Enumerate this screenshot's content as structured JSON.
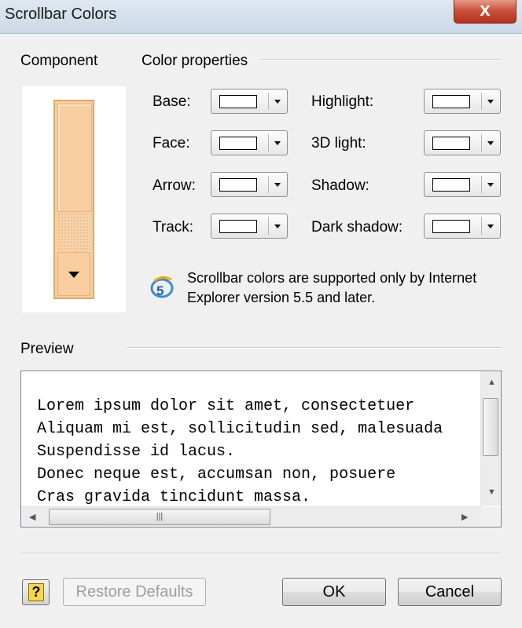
{
  "window": {
    "title": "Scrollbar Colors",
    "close_label": "x"
  },
  "component": {
    "label": "Component"
  },
  "color_properties": {
    "label": "Color properties",
    "left": [
      {
        "label": "Base:"
      },
      {
        "label": "Face:"
      },
      {
        "label": "Arrow:"
      },
      {
        "label": "Track:"
      }
    ],
    "right": [
      {
        "label": "Highlight:"
      },
      {
        "label": "3D light:"
      },
      {
        "label": "Shadow:"
      },
      {
        "label": "Dark shadow:"
      }
    ],
    "swatch_color": "#ffffff"
  },
  "info": {
    "icon": "ie5-icon",
    "line1": "Scrollbar colors are supported only by Internet",
    "line2": "Explorer version 5.5 and later."
  },
  "preview": {
    "label": "Preview",
    "lines": [
      "Lorem ipsum dolor sit amet, consectetuer",
      "Aliquam mi est, sollicitudin sed, malesuada",
      "Suspendisse id lacus.",
      "Donec neque est, accumsan non, posuere",
      "Cras gravida tincidunt massa."
    ]
  },
  "scrollbar_sample_colors": {
    "face": "#f8cda0",
    "border": "#e0a863",
    "track": "#f7d3ab",
    "arrow": "#000000"
  },
  "buttons": {
    "help": "?",
    "restore": "Restore Defaults",
    "ok": "OK",
    "cancel": "Cancel"
  }
}
